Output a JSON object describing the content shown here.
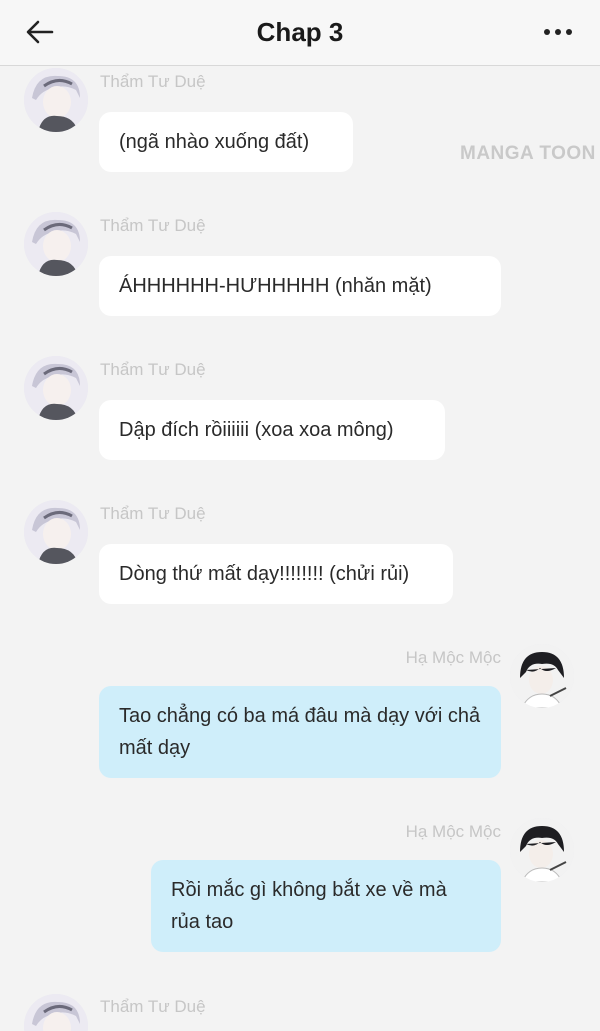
{
  "header": {
    "title": "Chap 3"
  },
  "watermark": "MANGA TOON",
  "messages": [
    {
      "sender": "Thẩm Tư Duệ",
      "side": "left",
      "text": "(ngã nhào xuống đất)"
    },
    {
      "sender": "Thẩm Tư Duệ",
      "side": "left",
      "text": "ÁHHHHHH-HƯHHHHH (nhăn mặt)"
    },
    {
      "sender": "Thẩm Tư Duệ",
      "side": "left",
      "text": "Dập đích rồiiiiii (xoa xoa mông)"
    },
    {
      "sender": "Thẩm Tư Duệ",
      "side": "left",
      "text": "Dòng thứ mất dạy!!!!!!!! (chửi rủi)"
    },
    {
      "sender": "Hạ Mộc Mộc",
      "side": "right",
      "text": "Tao chẳng có ba má đâu mà dạy với chả mất dạy"
    },
    {
      "sender": "Hạ Mộc Mộc",
      "side": "right",
      "text": "Rồi mắc gì không bắt xe về mà rủa tao"
    },
    {
      "sender": "Thẩm Tư Duệ",
      "side": "left",
      "text": ""
    }
  ],
  "colors": {
    "left_bubble": "#ffffff",
    "right_bubble": "#cfeefa",
    "background": "#f3f3f3"
  }
}
